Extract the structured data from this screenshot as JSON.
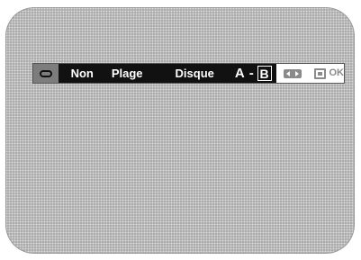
{
  "repeat_menu": {
    "icon": "repeat-icon",
    "options": {
      "off": "Non",
      "track": "Plage",
      "disc": "Disque",
      "ab_a": "A",
      "ab_dash": "-",
      "ab_b": "B"
    },
    "hints": {
      "navigate_icon": "left-right-arrows-icon",
      "enter_icon": "enter-icon",
      "ok": "OK"
    }
  }
}
